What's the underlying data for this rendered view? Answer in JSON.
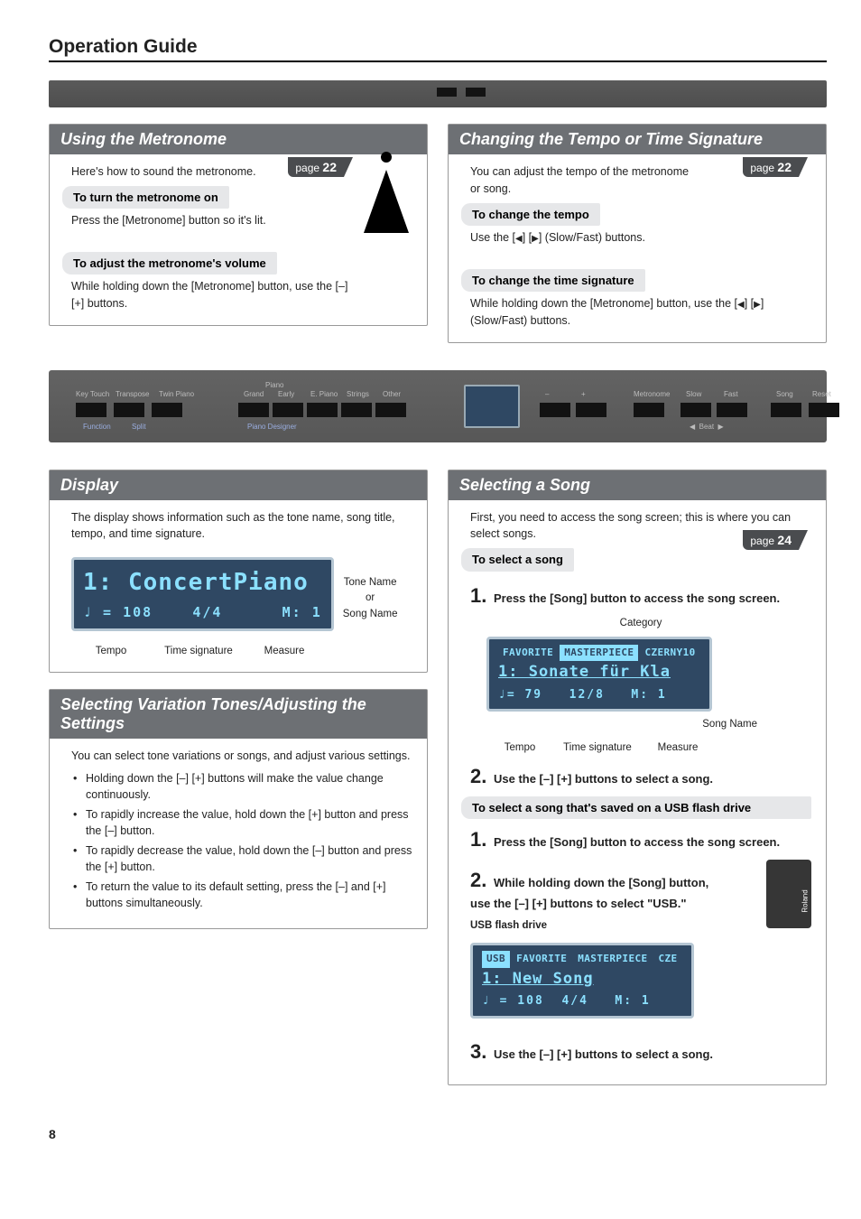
{
  "header": {
    "title": "Operation Guide"
  },
  "page_refs": {
    "p22": "page",
    "p22n": "22",
    "p24": "page",
    "p24n": "24"
  },
  "metronome": {
    "title": "Using the Metronome",
    "intro": "Here's how to sound the metronome.",
    "sub_on": "To turn the metronome on",
    "on_body": "Press the [Metronome] button so it's lit.",
    "sub_vol": "To adjust the metronome's volume",
    "vol_body": "While holding down the [Metronome] button, use the [–] [+] buttons."
  },
  "tempo": {
    "title": "Changing the Tempo or Time Signature",
    "intro": "You can adjust the tempo of the metronome or song.",
    "sub_tempo": "To change the tempo",
    "tempo_body_pre": "Use the [",
    "tempo_body_mid": "] [",
    "tempo_body_post": "] (Slow/Fast) buttons.",
    "sub_sig": "To change the time signature",
    "sig_body_pre": "While holding down the [Metronome] button, use the [",
    "sig_body_mid": "] [",
    "sig_body_post": "] (Slow/Fast) buttons."
  },
  "panel": {
    "labels": [
      "Key Touch",
      "Transpose",
      "Twin Piano",
      "Grand",
      "Early",
      "E. Piano",
      "Strings",
      "Other",
      "–",
      "+",
      "Metronome",
      "Slow",
      "Fast",
      "Song",
      "Reset"
    ],
    "sublabels": [
      "Function",
      "Split",
      "Piano",
      "Piano Designer",
      "Beat"
    ]
  },
  "display": {
    "title": "Display",
    "intro": "The display shows information such as the tone name, song title, tempo, and time signature.",
    "lcd_line1": "1: ConcertPiano",
    "lcd_tempo": "♩ = 108",
    "lcd_sig": "4/4",
    "lcd_measure": "M:  1",
    "annot": {
      "tempo": "Tempo",
      "sig": "Time signature",
      "meas": "Measure",
      "tone": "Tone Name\nor\nSong Name"
    }
  },
  "variation": {
    "title": "Selecting Variation Tones/Adjusting the Settings",
    "intro": "You can select tone variations or songs, and adjust various settings.",
    "bullets": [
      "Holding down the [–] [+] buttons will make the value change continuously.",
      "To rapidly increase the value, hold down the [+] button and press the [–] button.",
      "To rapidly decrease the value, hold down the [–] button and press the [+] button.",
      "To return the value to its default setting, press the [–] and [+] buttons simultaneously."
    ]
  },
  "song": {
    "title": "Selecting a Song",
    "intro": "First, you need to access the song screen; this is where you can select songs.",
    "sub_select": "To select a song",
    "step1": "Press the [Song] button to access the song screen.",
    "lcd_tabs": [
      "FAVORITE",
      "MASTERPIECE",
      "CZERNY10"
    ],
    "lcd_line1": "1: Sonate für Kla",
    "lcd_tempo": "♩= 79",
    "lcd_sig": "12/8",
    "lcd_measure": "M:  1",
    "annot": {
      "cat": "Category",
      "tempo": "Tempo",
      "sig": "Time signature",
      "meas": "Measure",
      "name": "Song Name"
    },
    "step2": "Use the [–] [+] buttons to select a song.",
    "sub_usb": "To select a song that's saved on a USB flash drive",
    "usb_step1": "Press the [Song] button to access the song screen.",
    "usb_step2": "While holding down the [Song] button, use the [–] [+] buttons to select \"USB.\"",
    "usb_annot": "USB flash drive",
    "usb_lcd_tabs": [
      "USB",
      "FAVORITE",
      "MASTERPIECE",
      "CZE"
    ],
    "usb_lcd_line1": "1: New Song",
    "usb_lcd_tempo": "♩ = 108",
    "usb_lcd_sig": "4/4",
    "usb_lcd_measure": "M:  1",
    "step3": "Use the [–] [+] buttons to select a song."
  },
  "footer": {
    "page_num": "8"
  }
}
